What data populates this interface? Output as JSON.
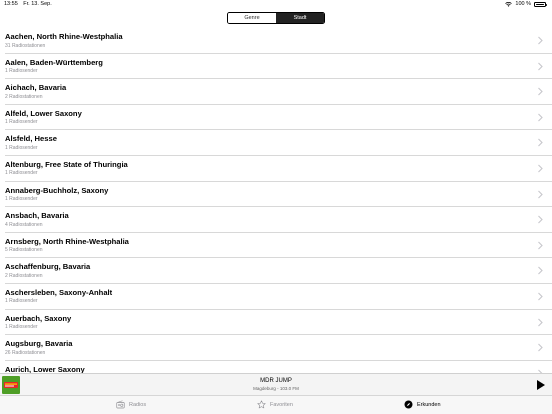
{
  "status": {
    "time": "13:55",
    "date": "Fr. 13. Sep.",
    "battery": "100 %"
  },
  "segmented": {
    "options": [
      "Genre",
      "Stadt"
    ],
    "selected": "Stadt"
  },
  "cities": [
    {
      "title": "Aachen, North Rhine-Westphalia",
      "subtitle": "31 Radiostationen"
    },
    {
      "title": "Aalen, Baden-Württemberg",
      "subtitle": "1 Radiosender"
    },
    {
      "title": "Aichach, Bavaria",
      "subtitle": "2 Radiostationen"
    },
    {
      "title": "Alfeld, Lower Saxony",
      "subtitle": "1 Radiosender"
    },
    {
      "title": "Alsfeld, Hesse",
      "subtitle": "1 Radiosender"
    },
    {
      "title": "Altenburg, Free State of Thuringia",
      "subtitle": "1 Radiosender"
    },
    {
      "title": "Annaberg-Buchholz, Saxony",
      "subtitle": "1 Radiosender"
    },
    {
      "title": "Ansbach, Bavaria",
      "subtitle": "4 Radiostationen"
    },
    {
      "title": "Arnsberg, North Rhine-Westphalia",
      "subtitle": "5 Radiostationen"
    },
    {
      "title": "Aschaffenburg, Bavaria",
      "subtitle": "2 Radiostationen"
    },
    {
      "title": "Aschersleben, Saxony-Anhalt",
      "subtitle": "1 Radiosender"
    },
    {
      "title": "Auerbach, Saxony",
      "subtitle": "1 Radiosender"
    },
    {
      "title": "Augsburg, Bavaria",
      "subtitle": "26 Radiostationen"
    },
    {
      "title": "Aurich, Lower Saxony",
      "subtitle": ""
    }
  ],
  "player": {
    "station": "MDR JUMP",
    "info": "Magdeburg - 103.0 FM"
  },
  "tabs": [
    {
      "label": "Radios",
      "icon": "radio-icon"
    },
    {
      "label": "Favoriten",
      "icon": "star-icon"
    },
    {
      "label": "Erkunden",
      "icon": "compass-icon",
      "active": true
    }
  ]
}
